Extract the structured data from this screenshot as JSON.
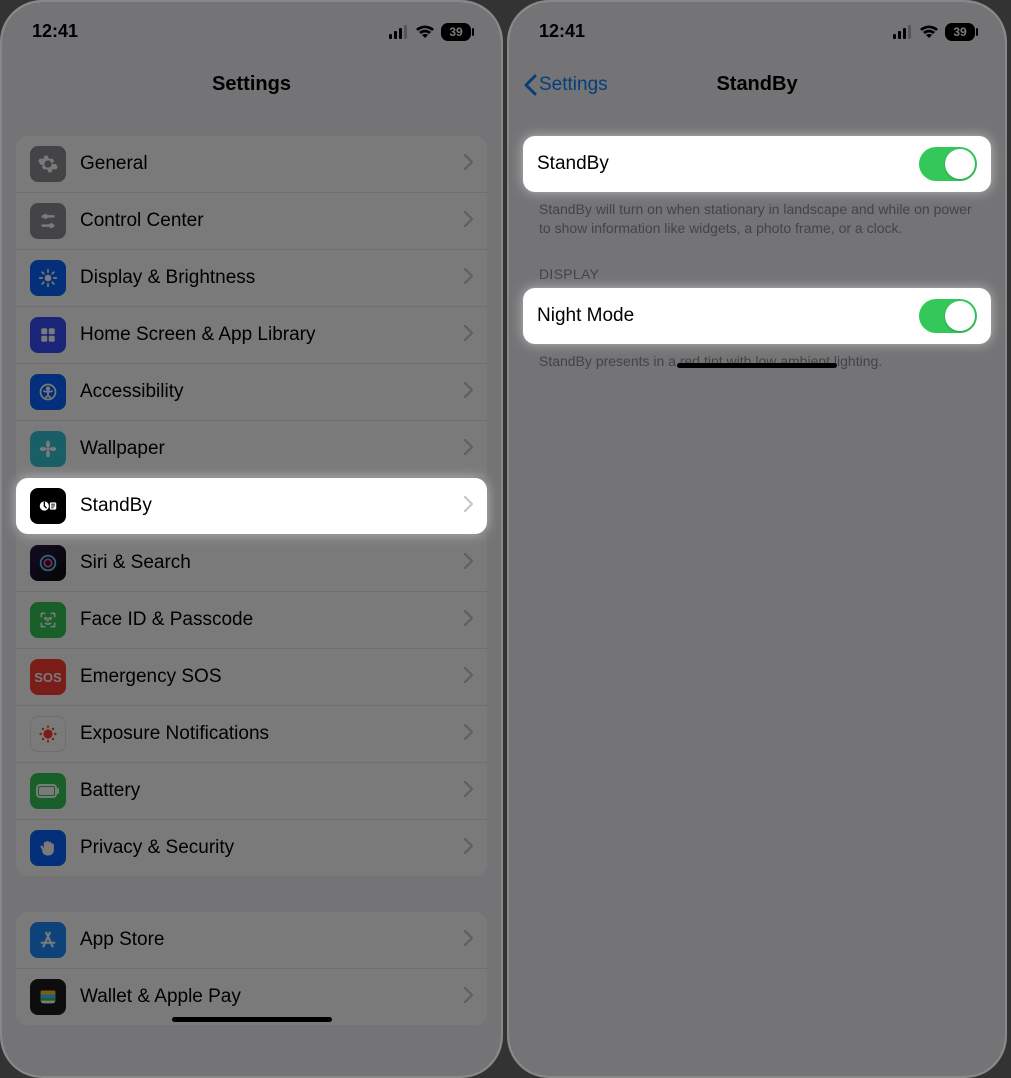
{
  "status": {
    "time": "12:41",
    "battery": "39"
  },
  "left": {
    "title": "Settings",
    "group1": [
      {
        "label": "General",
        "icon": "gear",
        "color": "#8e8e93"
      },
      {
        "label": "Control Center",
        "icon": "sliders",
        "color": "#8e8e93"
      },
      {
        "label": "Display & Brightness",
        "icon": "sun",
        "color": "#0a63ff"
      },
      {
        "label": "Home Screen & App Library",
        "icon": "grid",
        "color": "#2f5fff"
      },
      {
        "label": "Accessibility",
        "icon": "person",
        "color": "#0a63ff"
      },
      {
        "label": "Wallpaper",
        "icon": "flower",
        "color": "#4fc1d6"
      },
      {
        "label": "StandBy",
        "icon": "standby",
        "color": "#000000",
        "highlight": true
      },
      {
        "label": "Siri & Search",
        "icon": "siri",
        "color": "#1c1c1e"
      },
      {
        "label": "Face ID & Passcode",
        "icon": "face",
        "color": "#34c759"
      },
      {
        "label": "Emergency SOS",
        "icon": "sos",
        "color": "#ff3b30"
      },
      {
        "label": "Exposure Notifications",
        "icon": "virus",
        "color": "#ffffff"
      },
      {
        "label": "Battery",
        "icon": "batt",
        "color": "#34c759"
      },
      {
        "label": "Privacy & Security",
        "icon": "hand",
        "color": "#0a63ff"
      }
    ],
    "group2": [
      {
        "label": "App Store",
        "icon": "appstore",
        "color": "#1f8bff"
      },
      {
        "label": "Wallet & Apple Pay",
        "icon": "wallet",
        "color": "#1c1c1e"
      }
    ]
  },
  "right": {
    "back": "Settings",
    "title": "StandBy",
    "row1": {
      "label": "StandBy",
      "on": true
    },
    "footer1": "StandBy will turn on when stationary in landscape and while on power to show information like widgets, a photo frame, or a clock.",
    "section": "DISPLAY",
    "row2": {
      "label": "Night Mode",
      "on": true
    },
    "footer2": "StandBy presents in a red tint with low ambient lighting."
  }
}
